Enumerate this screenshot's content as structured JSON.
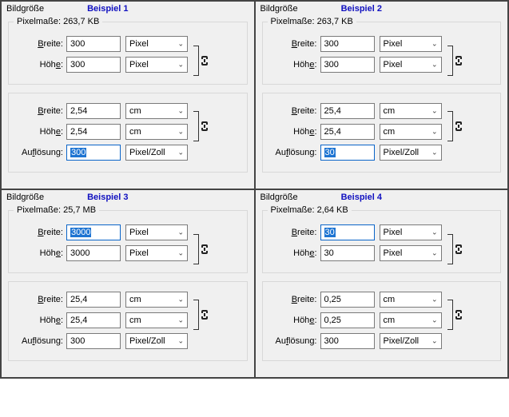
{
  "panels": [
    {
      "title": "Bildgröße",
      "example": "Beispiel 1",
      "pixelDims": {
        "legend": "Pixelmaße: 263,7 KB",
        "width": {
          "label": "Breite:",
          "value": "300",
          "unit": "Pixel",
          "selected": false
        },
        "height": {
          "label": "Höhe:",
          "value": "300",
          "unit": "Pixel",
          "selected": false
        }
      },
      "docSize": {
        "width": {
          "label": "Breite:",
          "value": "2,54",
          "unit": "cm",
          "selected": false
        },
        "height": {
          "label": "Höhe:",
          "value": "2,54",
          "unit": "cm",
          "selected": false
        },
        "resolution": {
          "label": "Auflösung:",
          "value": "300",
          "unit": "Pixel/Zoll",
          "selected": true
        }
      }
    },
    {
      "title": "Bildgröße",
      "example": "Beispiel 2",
      "pixelDims": {
        "legend": "Pixelmaße: 263,7 KB",
        "width": {
          "label": "Breite:",
          "value": "300",
          "unit": "Pixel",
          "selected": false
        },
        "height": {
          "label": "Höhe:",
          "value": "300",
          "unit": "Pixel",
          "selected": false
        }
      },
      "docSize": {
        "width": {
          "label": "Breite:",
          "value": "25,4",
          "unit": "cm",
          "selected": false
        },
        "height": {
          "label": "Höhe:",
          "value": "25,4",
          "unit": "cm",
          "selected": false
        },
        "resolution": {
          "label": "Auflösung:",
          "value": "30",
          "unit": "Pixel/Zoll",
          "selected": true
        }
      }
    },
    {
      "title": "Bildgröße",
      "example": "Beispiel 3",
      "pixelDims": {
        "legend": "Pixelmaße: 25,7 MB",
        "width": {
          "label": "Breite:",
          "value": "3000",
          "unit": "Pixel",
          "selected": true
        },
        "height": {
          "label": "Höhe:",
          "value": "3000",
          "unit": "Pixel",
          "selected": false
        }
      },
      "docSize": {
        "width": {
          "label": "Breite:",
          "value": "25,4",
          "unit": "cm",
          "selected": false
        },
        "height": {
          "label": "Höhe:",
          "value": "25,4",
          "unit": "cm",
          "selected": false
        },
        "resolution": {
          "label": "Auflösung:",
          "value": "300",
          "unit": "Pixel/Zoll",
          "selected": false
        }
      }
    },
    {
      "title": "Bildgröße",
      "example": "Beispiel 4",
      "pixelDims": {
        "legend": "Pixelmaße: 2,64 KB",
        "width": {
          "label": "Breite:",
          "value": "30",
          "unit": "Pixel",
          "selected": true
        },
        "height": {
          "label": "Höhe:",
          "value": "30",
          "unit": "Pixel",
          "selected": false
        }
      },
      "docSize": {
        "width": {
          "label": "Breite:",
          "value": "0,25",
          "unit": "cm",
          "selected": false
        },
        "height": {
          "label": "Höhe:",
          "value": "0,25",
          "unit": "cm",
          "selected": false
        },
        "resolution": {
          "label": "Auflösung:",
          "value": "300",
          "unit": "Pixel/Zoll",
          "selected": false
        }
      }
    }
  ]
}
